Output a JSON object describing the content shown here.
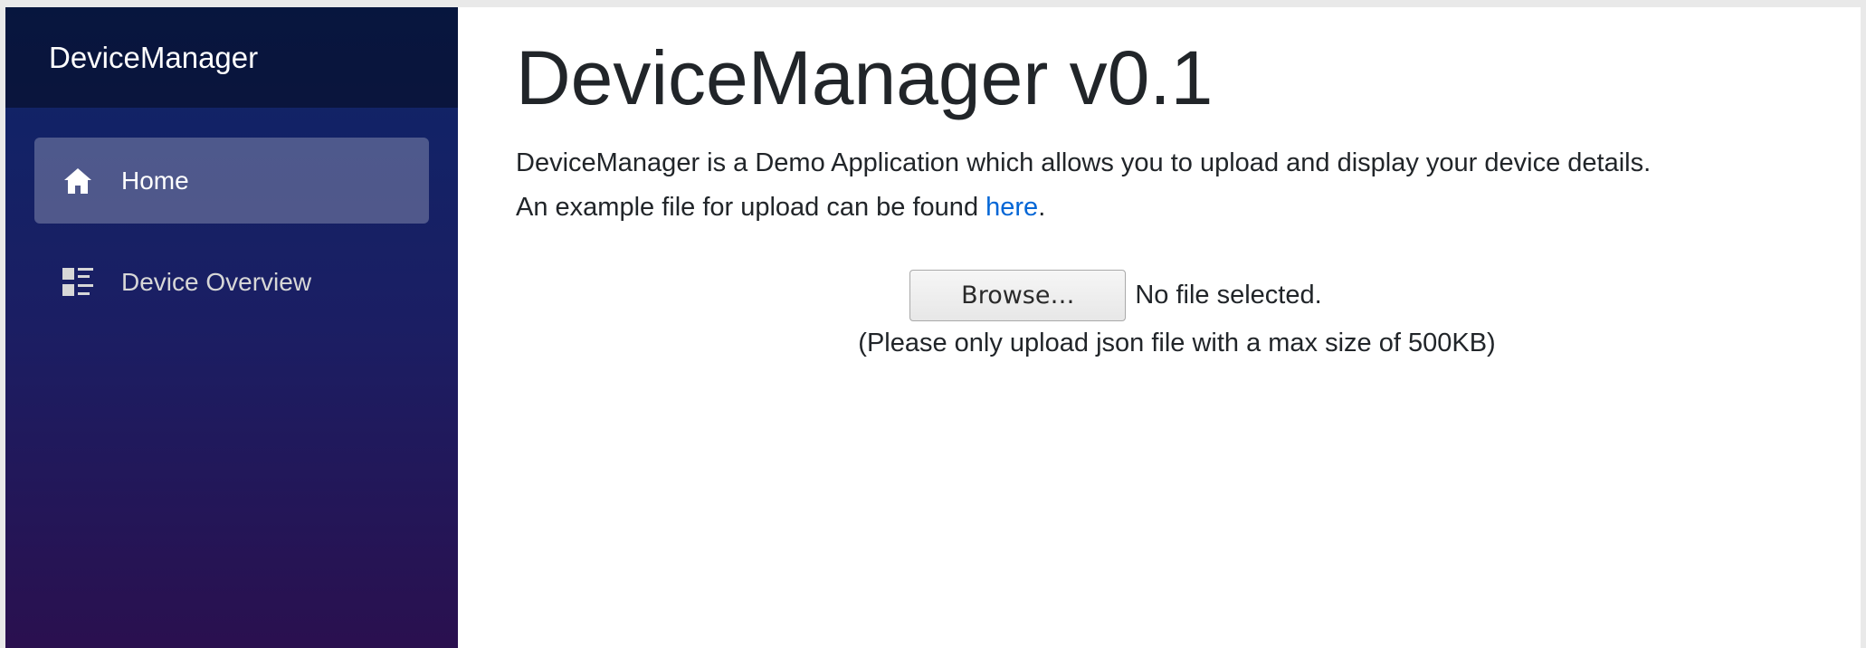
{
  "sidebar": {
    "brand": "DeviceManager",
    "items": [
      {
        "label": "Home",
        "icon": "home-icon",
        "active": true
      },
      {
        "label": "Device Overview",
        "icon": "list-icon",
        "active": false
      }
    ]
  },
  "main": {
    "title": "DeviceManager v0.1",
    "description_line1": "DeviceManager is a Demo Application which allows you to upload and display your device details.",
    "description_line2_prefix": "An example file for upload can be found ",
    "description_link": "here",
    "description_line2_suffix": "."
  },
  "upload": {
    "browse_label": "Browse…",
    "file_status": "No file selected.",
    "note": "(Please only upload json file with a max size of 500KB)"
  },
  "colors": {
    "sidebar_top": "#0d2568",
    "sidebar_bottom": "#2a104f",
    "link": "#0366d6",
    "text": "#212529"
  }
}
